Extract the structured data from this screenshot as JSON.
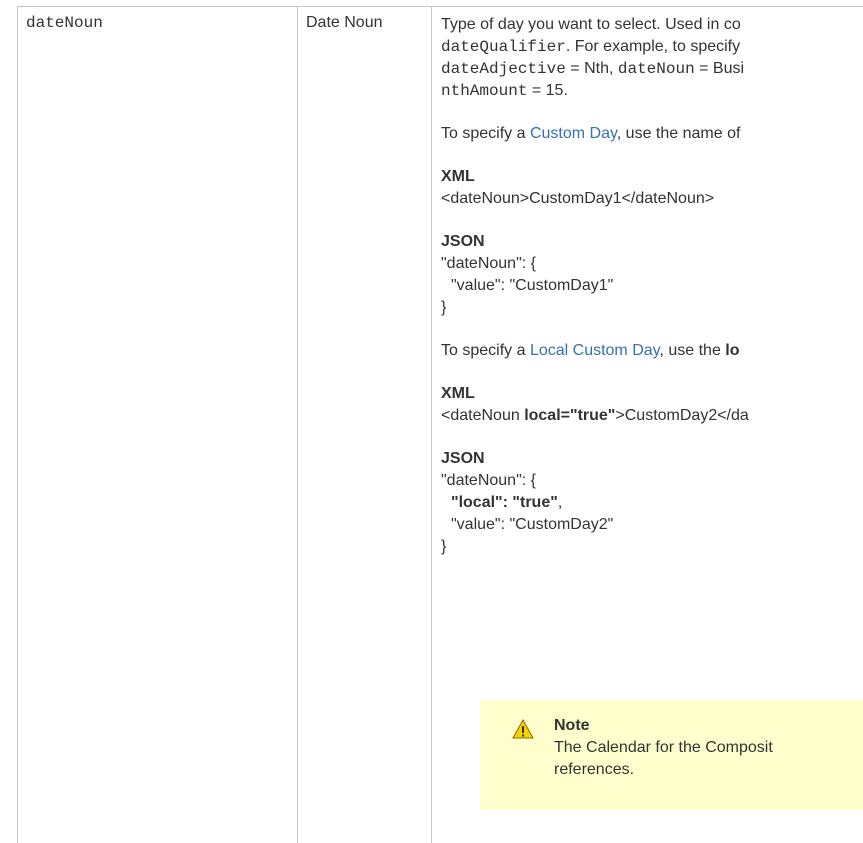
{
  "row": {
    "parameter": "dateNoun",
    "name": "Date Noun",
    "description": {
      "intro_text1": "Type of day you want to select. Used in co",
      "intro_code1": "dateQualifier",
      "intro_text2": ". For example, to specify",
      "intro_code2": "dateAdjective",
      "intro_text3": " = Nth, ",
      "intro_code3": "dateNoun",
      "intro_text4": " = Busi",
      "intro_code4": "nthAmount",
      "intro_text5": " = 15.",
      "custom_prefix": "To specify a ",
      "custom_link": "Custom Day",
      "custom_suffix": ", use the name of",
      "xml_label": "XML",
      "xml_example1": "<dateNoun>CustomDay1</dateNoun>",
      "json_label": "JSON",
      "json1_line1": "\"dateNoun\": {",
      "json1_line2": "\"value\": \"CustomDay1\"",
      "json1_line3": "}",
      "local_prefix": "To specify a ",
      "local_link": "Local Custom Day",
      "local_mid": ", use the ",
      "local_bold": "lo",
      "xml_label2": "XML",
      "xml2_open": "<dateNoun ",
      "xml2_bold": "local=\"true\"",
      "xml2_rest": ">CustomDay2</da",
      "json_label2": "JSON",
      "json2_line1": "\"dateNoun\": {",
      "json2_line2_bold": "\"local\": \"true\"",
      "json2_line2_rest": ",",
      "json2_line3": "\"value\": \"CustomDay2\"",
      "json2_line4": "}"
    },
    "note": {
      "icon": "warning-icon",
      "title": "Note",
      "line1": "The Calendar for the Composit",
      "line2": "references."
    }
  },
  "colors": {
    "border": "#c1c7d0",
    "link": "#3572b0",
    "note_bg": "#ffffce",
    "text": "#333333"
  }
}
